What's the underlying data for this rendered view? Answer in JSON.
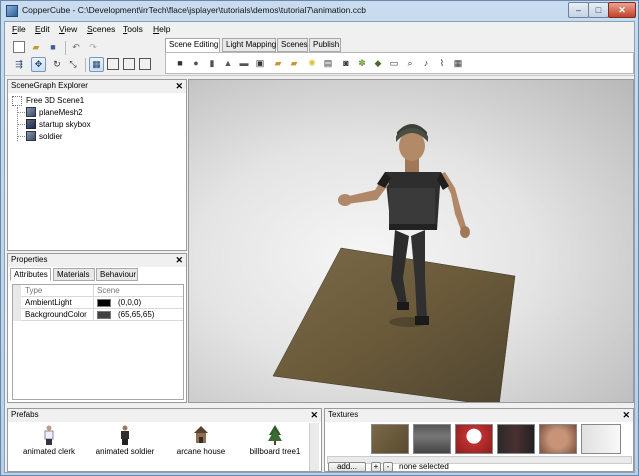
{
  "window": {
    "title": "CopperCube - C:\\Development\\irrTech\\flace\\jsplayer\\tutorials\\demos\\tutorial7\\animation.ccb",
    "min": "–",
    "max": "□",
    "close": "✕"
  },
  "menu": [
    {
      "key": "F",
      "rest": "ile"
    },
    {
      "key": "E",
      "rest": "dit"
    },
    {
      "key": "V",
      "rest": "iew"
    },
    {
      "key": "S",
      "rest": "cenes"
    },
    {
      "key": "T",
      "rest": "ools"
    },
    {
      "key": "H",
      "rest": "elp"
    }
  ],
  "mode_tabs": [
    "Scene Editing",
    "Light Mapping",
    "Scenes",
    "Publish"
  ],
  "scenegraph": {
    "title": "SceneGraph Explorer",
    "close": "✕",
    "root": "Free 3D Scene1",
    "children": [
      "planeMesh2",
      "startup skybox",
      "soldier"
    ]
  },
  "properties": {
    "title": "Properties",
    "close": "✕",
    "tabs": [
      "Attributes",
      "Materials",
      "Behaviour"
    ],
    "grid_header": {
      "type": "Type",
      "value": "Scene"
    },
    "rows": [
      {
        "name": "AmbientLight",
        "value": "(0,0,0)",
        "color": "#000000"
      },
      {
        "name": "BackgroundColor",
        "value": "(65,65,65)",
        "color": "#414141"
      }
    ]
  },
  "prefabs": {
    "title": "Prefabs",
    "close": "✕",
    "items": [
      "animated clerk",
      "animated soldier",
      "arcane house",
      "billboard tree1"
    ]
  },
  "textures": {
    "title": "Textures",
    "close": "✕",
    "add_label": "add...",
    "plus": "+",
    "minus": "-",
    "status": "none selected"
  }
}
